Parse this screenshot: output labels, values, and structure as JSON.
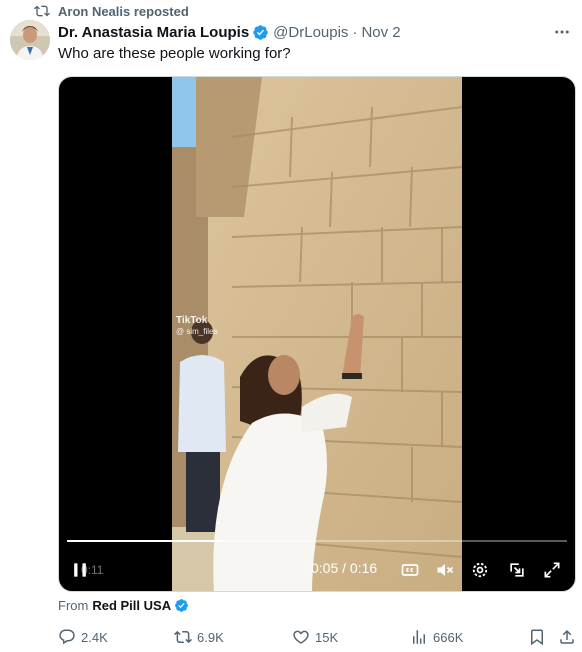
{
  "repost": {
    "label": "Aron Nealis reposted"
  },
  "author": {
    "name": "Dr. Anastasia Maria Loupis",
    "handle": "@DrLoupis",
    "separator": "·",
    "date": "Nov 2"
  },
  "tweet": {
    "text": "Who are these people working for?"
  },
  "video": {
    "watermark_brand": "TikTok",
    "watermark_user": "@ sim_files",
    "thumb_time": "0:11",
    "current_time": "0:05",
    "time_separator": " / ",
    "duration": "0:16",
    "progress": 0.31
  },
  "source": {
    "prefix": "From",
    "name": "Red Pill USA"
  },
  "stats": {
    "replies": "2.4K",
    "reposts": "6.9K",
    "likes": "15K",
    "views": "666K"
  },
  "colors": {
    "verified": "#1d9bf0",
    "muted_text": "#536471",
    "text": "#0f1419"
  },
  "icons": [
    "repost-icon",
    "verified-icon",
    "more-icon",
    "pause-icon",
    "cc-icon",
    "mute-icon",
    "settings-icon",
    "pip-icon",
    "fullscreen-icon",
    "reply-icon",
    "retweet-icon",
    "like-icon",
    "views-icon",
    "bookmark-icon",
    "share-icon"
  ]
}
